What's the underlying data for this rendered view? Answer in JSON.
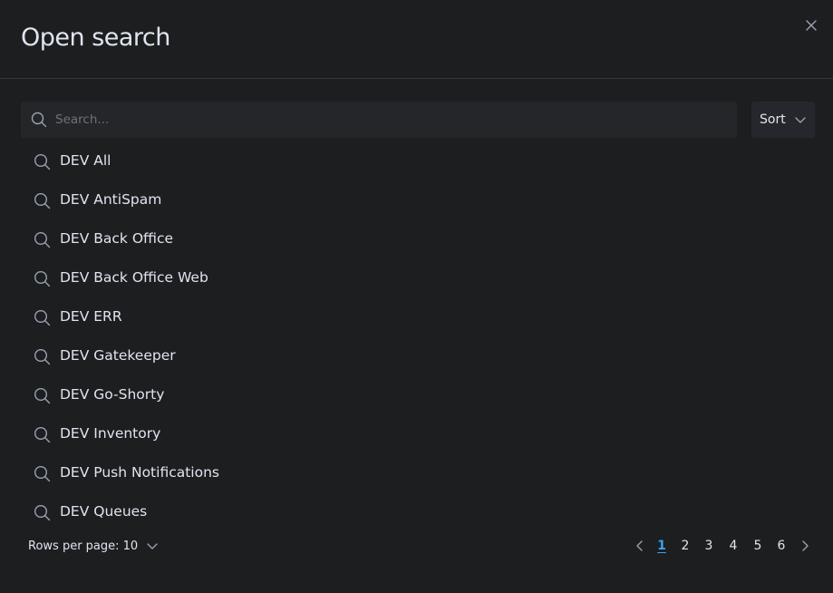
{
  "flyout": {
    "title": "Open search",
    "close_icon": "close-icon"
  },
  "search": {
    "placeholder": "Search...",
    "value": "",
    "icon": "search-icon"
  },
  "sort": {
    "label": "Sort",
    "icon": "chevron-down-icon"
  },
  "results": [
    {
      "label": "DEV All",
      "icon": "search-icon"
    },
    {
      "label": "DEV AntiSpam",
      "icon": "search-icon"
    },
    {
      "label": "DEV Back Office",
      "icon": "search-icon"
    },
    {
      "label": "DEV Back Office Web",
      "icon": "search-icon"
    },
    {
      "label": "DEV ERR",
      "icon": "search-icon"
    },
    {
      "label": "DEV Gatekeeper",
      "icon": "search-icon"
    },
    {
      "label": "DEV Go-Shorty",
      "icon": "search-icon"
    },
    {
      "label": "DEV Inventory",
      "icon": "search-icon"
    },
    {
      "label": "DEV Push Notifications",
      "icon": "search-icon"
    },
    {
      "label": "DEV Queues",
      "icon": "search-icon"
    }
  ],
  "footer": {
    "rows_per_page": "Rows per page: 10",
    "pages": [
      "1",
      "2",
      "3",
      "4",
      "5",
      "6"
    ],
    "current_page": "1"
  },
  "colors": {
    "background": "#1d1e20",
    "text": "#dfe5ef",
    "muted": "#98a2b3",
    "accent": "#36a2ef",
    "border": "#343741"
  }
}
